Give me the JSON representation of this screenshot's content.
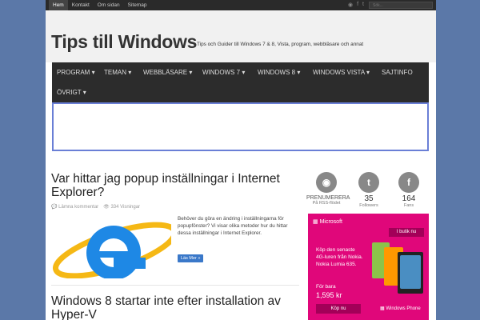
{
  "topbar": {
    "nav": [
      "Hem",
      "Kontakt",
      "Om sidan",
      "Sitemap"
    ],
    "search_placeholder": "Sök..."
  },
  "header": {
    "logo": "Tips till Windows",
    "tagline": "Tips och Guider till Windows 7 & 8, Vista, program, webbläsare och annat"
  },
  "menu": {
    "items": [
      "PROGRAM",
      "TEMAN",
      "WEBBLÄSARE",
      "WINDOWS 7",
      "WINDOWS 8",
      "WINDOWS VISTA",
      "SAJTINFO",
      "ÖVRIGT"
    ],
    "has_dropdown": [
      true,
      true,
      true,
      true,
      true,
      true,
      false,
      true
    ]
  },
  "post1": {
    "title": "Var hittar jag popup inställningar i Internet Explorer?",
    "comments": "Lämna kommentar",
    "views": "334 Visningar",
    "excerpt": "Behöver du göra en ändring i inställningarna för popupfönster? Vi visar olika metoder hur du hittar dessa inställningar i Internet Explorer.",
    "read_more": "Läs Mer »"
  },
  "post2": {
    "title": "Windows 8 startar inte efter installation av Hyper-V"
  },
  "social": {
    "rss_label": "PRENUMERERA",
    "rss_sub": "På RSS-flödet",
    "twitter_count": "35",
    "twitter_label": "Followers",
    "facebook_count": "164",
    "facebook_label": "Fans"
  },
  "ad_microsoft": {
    "brand": "Microsoft",
    "shop": "I butik nu",
    "text": "Köp den senaste 4G-luren från Nokia. Nokia Lumia 635.",
    "price_label": "För bara",
    "price": "1,595 kr",
    "button": "Köp nu",
    "footer": "Windows Phone"
  },
  "colors": {
    "background": "#5b78a8",
    "menu": "#2c2c2c",
    "accent": "#3a78c9",
    "ad_pink": "#e0077a"
  }
}
